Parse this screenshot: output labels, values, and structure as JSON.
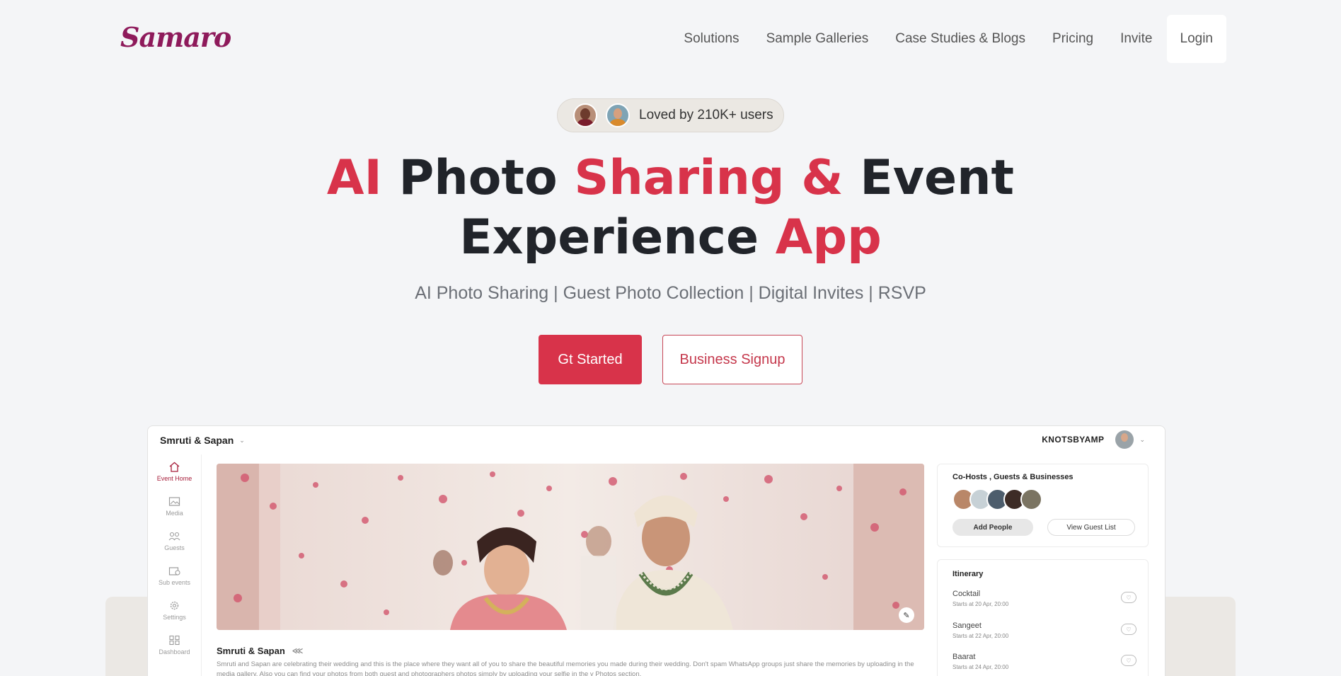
{
  "nav": {
    "logo": "Samaro",
    "links": [
      "Solutions",
      "Sample Galleries",
      "Case Studies & Blogs",
      "Pricing",
      "Invite"
    ],
    "login": "Login"
  },
  "hero": {
    "badge_text": "Loved by 210K+ users",
    "headline": {
      "p1": "AI",
      "p2": " Photo ",
      "p3": "Sharing &",
      "p4": " Event",
      "p5": "Experience ",
      "p6": "App"
    },
    "subtitle": "AI Photo Sharing | Guest Photo Collection | Digital Invites | RSVP",
    "cta_primary": "Gt Started",
    "cta_secondary": "Business Signup"
  },
  "app": {
    "event_selector": "Smruti & Sapan",
    "brand": "KNOTSBYAMP",
    "sidebar": [
      "Event Home",
      "Media",
      "Guests",
      "Sub events",
      "Settings",
      "Dashboard"
    ],
    "event_title": "Smruti & Sapan",
    "description": "Smruti and Sapan are celebrating their wedding and this is the place where they want all of you to share the beautiful memories you made during their wedding. Don't spam WhatsApp groups just share the memories by uploading in the media gallery. Also you can find your photos from both guest and photographers photos simply by uploading your selfie in the y Photos section.",
    "cohosts_title": "Co-Hosts , Guests & Businesses",
    "add_people": "Add People",
    "view_guest_list": "View Guest List",
    "itinerary_title": "Itinerary",
    "itinerary": [
      {
        "name": "Cocktail",
        "when": "Starts at 20 Apr, 20:00"
      },
      {
        "name": "Sangeet",
        "when": "Starts at 22 Apr, 20:00"
      },
      {
        "name": "Baarat",
        "when": "Starts at 24 Apr, 20:00"
      }
    ]
  },
  "colors": {
    "accent": "#d8334a",
    "logo": "#8e1a5b",
    "background": "#f4f5f7"
  }
}
